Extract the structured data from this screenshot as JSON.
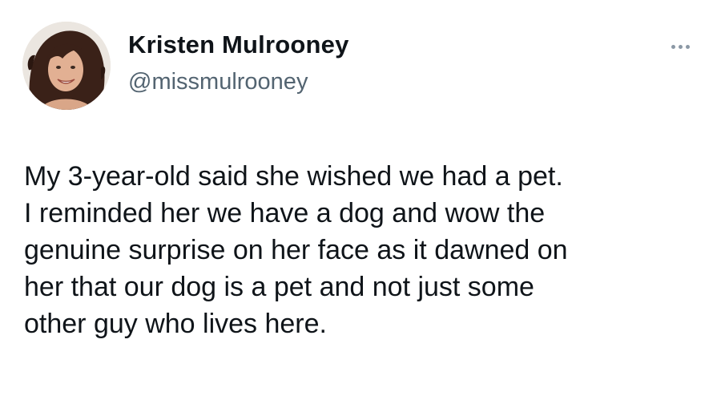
{
  "author": {
    "display_name": "Kristen Mulrooney",
    "handle": "@missmulrooney",
    "avatar_icon": "profile-photo"
  },
  "menu": {
    "icon": "more-options-icon"
  },
  "tweet": {
    "lines": [
      "My 3-year-old said she wished we had a pet.",
      "I reminded her we have a dog and wow the",
      "genuine surprise on her face as it dawned on",
      "her that our dog is a pet and not just some",
      "other guy who lives here."
    ]
  },
  "colors": {
    "text": "#0f1419",
    "secondary": "#536471",
    "background": "#ffffff"
  }
}
